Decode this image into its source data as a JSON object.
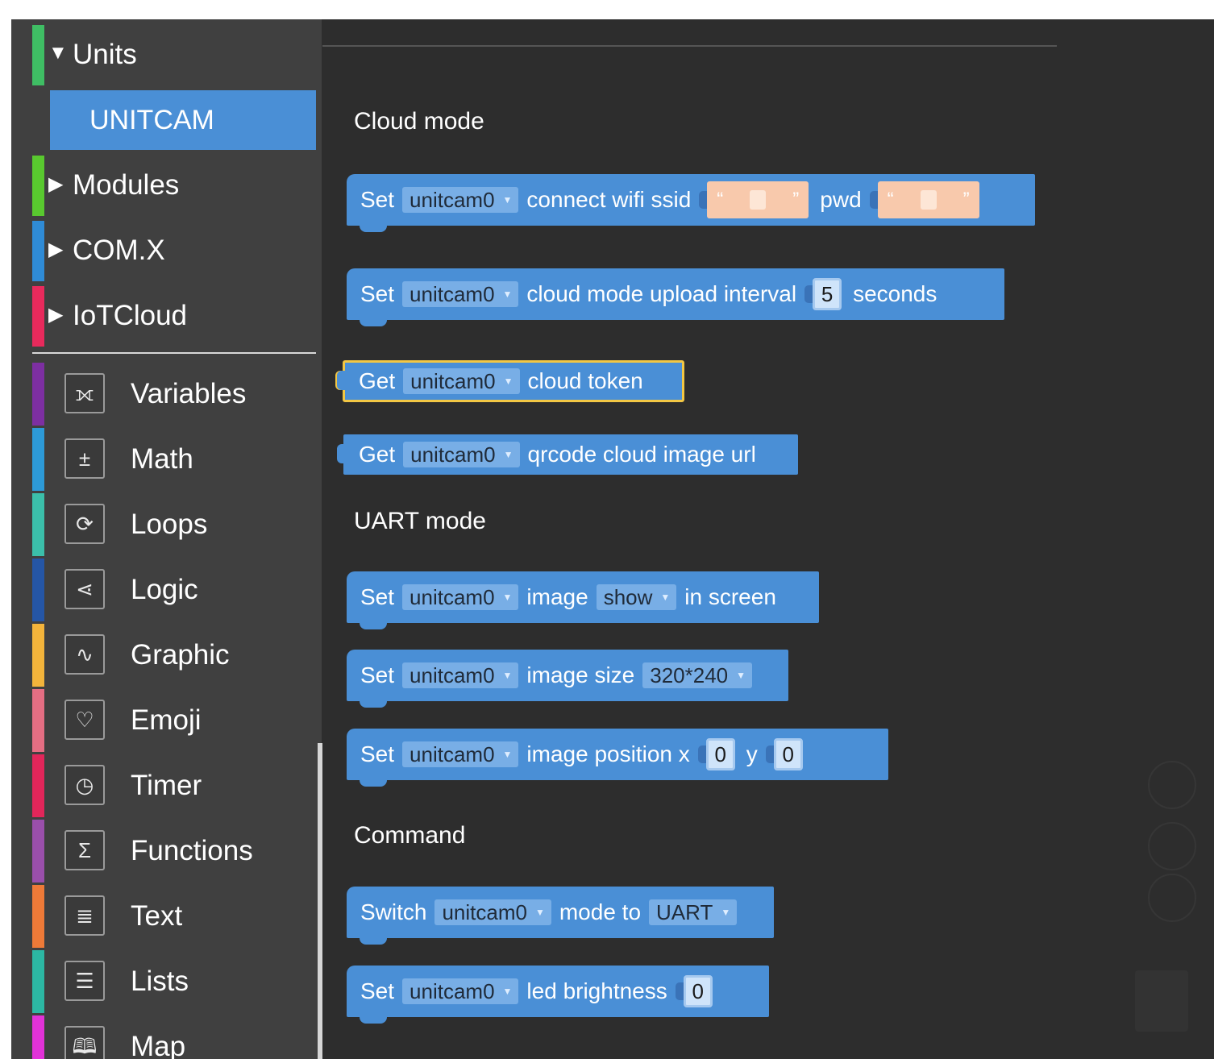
{
  "toolbox": {
    "expandable": [
      {
        "label": "Units",
        "arrow": "▼",
        "color": "#3fbe64"
      },
      {
        "label": "Modules",
        "arrow": "▶",
        "color": "#59c92f"
      },
      {
        "label": "COM.X",
        "arrow": "▶",
        "color": "#2f8bd6"
      },
      {
        "label": "IoTCloud",
        "arrow": "▶",
        "color": "#e82a5c"
      }
    ],
    "selected_unit": "UNITCAM",
    "categories": [
      {
        "label": "Variables",
        "icon": "variables-icon",
        "glyph": "⟗",
        "color": "#7d2fa2"
      },
      {
        "label": "Math",
        "icon": "math-icon",
        "glyph": "±",
        "color": "#2d9ad8"
      },
      {
        "label": "Loops",
        "icon": "loops-icon",
        "glyph": "⟳",
        "color": "#3bbfaa"
      },
      {
        "label": "Logic",
        "icon": "logic-icon",
        "glyph": "⋖",
        "color": "#2556a6"
      },
      {
        "label": "Graphic",
        "icon": "graphic-icon",
        "glyph": "∿",
        "color": "#f3b43b"
      },
      {
        "label": "Emoji",
        "icon": "emoji-icon",
        "glyph": "♡",
        "color": "#e56e83"
      },
      {
        "label": "Timer",
        "icon": "timer-icon",
        "glyph": "◷",
        "color": "#e2265a"
      },
      {
        "label": "Functions",
        "icon": "functions-icon",
        "glyph": "Σ",
        "color": "#9a4fab"
      },
      {
        "label": "Text",
        "icon": "text-icon",
        "glyph": "≣",
        "color": "#ee7a38"
      },
      {
        "label": "Lists",
        "icon": "lists-icon",
        "glyph": "☰",
        "color": "#2cb7a3"
      },
      {
        "label": "Map",
        "icon": "map-icon",
        "glyph": "🕮",
        "color": "#e232d8"
      }
    ]
  },
  "flyout": {
    "sections": {
      "cloud": "Cloud mode",
      "uart": "UART mode",
      "command": "Command"
    },
    "device": "unitcam0",
    "blocks": {
      "wifi": {
        "set": "Set",
        "text": "connect wifi ssid",
        "pwd": "pwd",
        "open_q": "“",
        "close_q": "”"
      },
      "upload": {
        "set": "Set",
        "text": "cloud mode upload interval",
        "value": "5",
        "unit": "seconds"
      },
      "token": {
        "get": "Get",
        "text": "cloud token"
      },
      "qrcode": {
        "get": "Get",
        "text": "qrcode cloud image url"
      },
      "show": {
        "set": "Set",
        "text1": "image",
        "option": "show",
        "text2": "in screen"
      },
      "size": {
        "set": "Set",
        "text": "image size",
        "option": "320*240"
      },
      "position": {
        "set": "Set",
        "text": "image position x",
        "x": "0",
        "y_label": "y",
        "y": "0"
      },
      "switch": {
        "switch": "Switch",
        "text": "mode to",
        "option": "UART"
      },
      "led": {
        "set": "Set",
        "text": "led brightness",
        "value": "0"
      }
    }
  }
}
